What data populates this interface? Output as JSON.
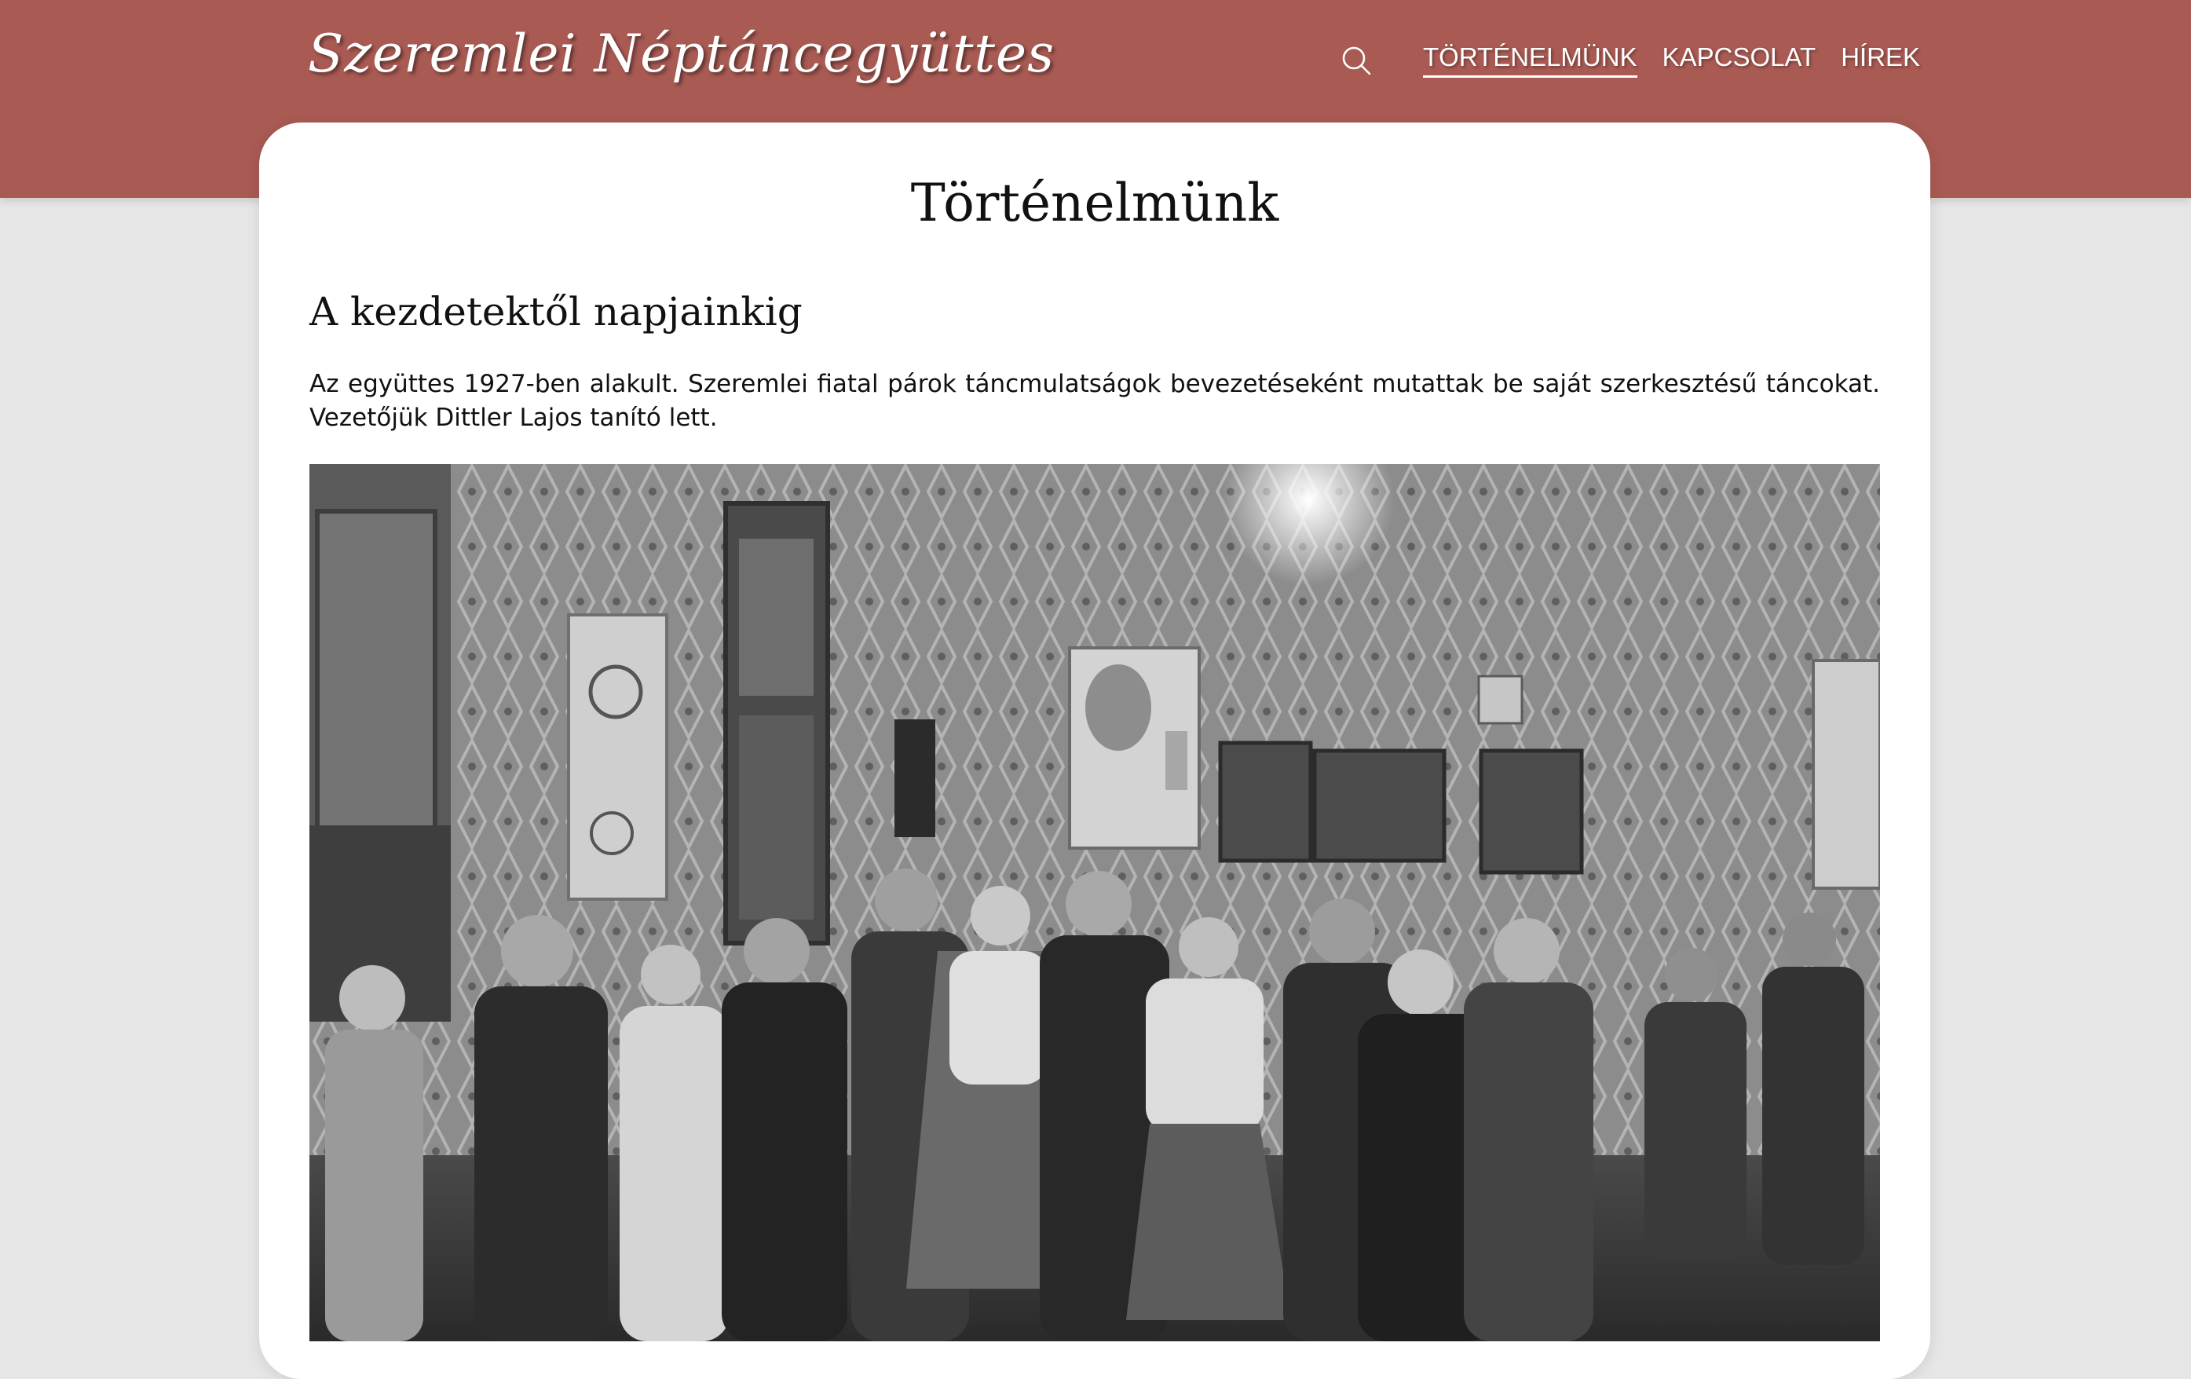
{
  "header": {
    "logo_text": "Szeremlei Néptáncegyüttes",
    "nav": [
      {
        "label": "TÖRTÉNELMÜNK",
        "active": true
      },
      {
        "label": "KAPCSOLAT",
        "active": false
      },
      {
        "label": "HÍREK",
        "active": false
      }
    ],
    "search_icon": "search-icon"
  },
  "main": {
    "title": "Történelmünk",
    "section_title": "A kezdetektől napjainkig",
    "paragraph": "Az együttes 1927-ben alakult. Szeremlei fiatal párok táncmulatságok bevezetéseként mutattak be saját szerkesztésű táncokat. Vezetőjük Dittler Lajos tanító lett."
  },
  "colors": {
    "header_bg": "#a85a53",
    "page_bg": "#e6e6e6",
    "card_bg": "#ffffff"
  }
}
